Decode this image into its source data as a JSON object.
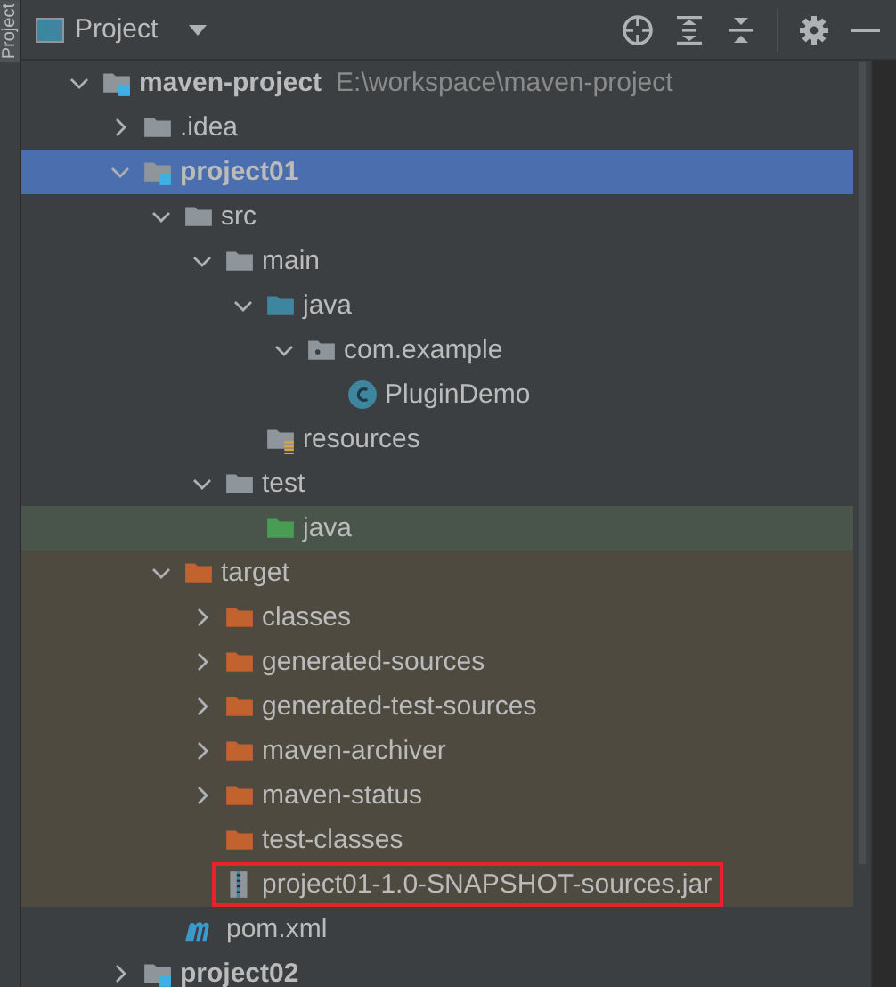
{
  "side_strip": {
    "label": "Project"
  },
  "toolbar": {
    "title": "Project"
  },
  "tree": [
    {
      "name": "maven-project",
      "path": "E:\\workspace\\maven-project",
      "kind": "module",
      "bold": true,
      "expanded": true,
      "selected": false,
      "children": [
        {
          "name": ".idea",
          "kind": "folder",
          "expanded": false,
          "selected": false
        },
        {
          "name": "project01",
          "kind": "module",
          "bold": true,
          "expanded": true,
          "selected": true,
          "children": [
            {
              "name": "src",
              "kind": "folder",
              "expanded": true,
              "selected": false,
              "children": [
                {
                  "name": "main",
                  "kind": "folder",
                  "expanded": true,
                  "selected": false,
                  "children": [
                    {
                      "name": "java",
                      "kind": "source",
                      "expanded": true,
                      "selected": false,
                      "children": [
                        {
                          "name": "com.example",
                          "kind": "package",
                          "expanded": true,
                          "selected": false,
                          "children": [
                            {
                              "name": "PluginDemo",
                              "kind": "class",
                              "selected": false
                            }
                          ]
                        }
                      ]
                    },
                    {
                      "name": "resources",
                      "kind": "resources",
                      "selected": false
                    }
                  ]
                },
                {
                  "name": "test",
                  "kind": "folder",
                  "expanded": true,
                  "selected": false,
                  "children": [
                    {
                      "name": "java",
                      "kind": "test",
                      "selected": false
                    }
                  ]
                }
              ]
            },
            {
              "name": "target",
              "kind": "excluded",
              "expanded": true,
              "selected": false,
              "children": [
                {
                  "name": "classes",
                  "kind": "excluded",
                  "expanded": false,
                  "selected": false
                },
                {
                  "name": "generated-sources",
                  "kind": "excluded",
                  "expanded": false,
                  "selected": false
                },
                {
                  "name": "generated-test-sources",
                  "kind": "excluded",
                  "expanded": false,
                  "selected": false
                },
                {
                  "name": "maven-archiver",
                  "kind": "excluded",
                  "expanded": false,
                  "selected": false
                },
                {
                  "name": "maven-status",
                  "kind": "excluded",
                  "expanded": false,
                  "selected": false
                },
                {
                  "name": "test-classes",
                  "kind": "excluded",
                  "selected": false
                },
                {
                  "name": "project01-1.0-SNAPSHOT-sources.jar",
                  "kind": "jar",
                  "highlighted": true,
                  "selected": false
                }
              ]
            },
            {
              "name": "pom.xml",
              "kind": "maven",
              "selected": false
            }
          ]
        },
        {
          "name": "project02",
          "kind": "module",
          "bold": true,
          "expanded": false,
          "selected": false
        }
      ]
    }
  ]
}
